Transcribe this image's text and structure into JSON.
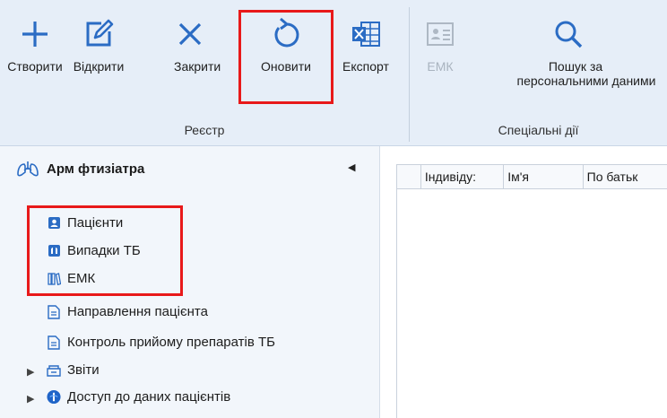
{
  "ribbon": {
    "groups": [
      {
        "label": "Реєстр"
      },
      {
        "label": "Спеціальні дії"
      }
    ],
    "buttons": {
      "create": "Створити",
      "open": "Відкрити",
      "close": "Закрити",
      "refresh": "Оновити",
      "export": "Експорт",
      "emk": "ЕМК",
      "search_line1": "Пошук за",
      "search_line2": "персональними даними"
    },
    "accent_color": "#2b6cc4",
    "highlight_color": "#e8191a"
  },
  "sidebar": {
    "title": "Арм фтизіатра",
    "items": [
      {
        "label": "Пацієнти",
        "icon": "patient-card-icon"
      },
      {
        "label": "Випадки ТБ",
        "icon": "lungs-case-icon"
      },
      {
        "label": "ЕМК",
        "icon": "books-icon"
      },
      {
        "label": "Направлення пацієнта",
        "icon": "document-icon"
      },
      {
        "label": "Контроль прийому препаратів ТБ",
        "icon": "document-icon"
      },
      {
        "label": "Звіти",
        "icon": "reports-icon"
      },
      {
        "label": "Доступ до даних пацієнтів",
        "icon": "info-globe-icon"
      }
    ]
  },
  "grid": {
    "columns": [
      "Індивіду:",
      "Ім'я",
      "По батьк"
    ]
  }
}
